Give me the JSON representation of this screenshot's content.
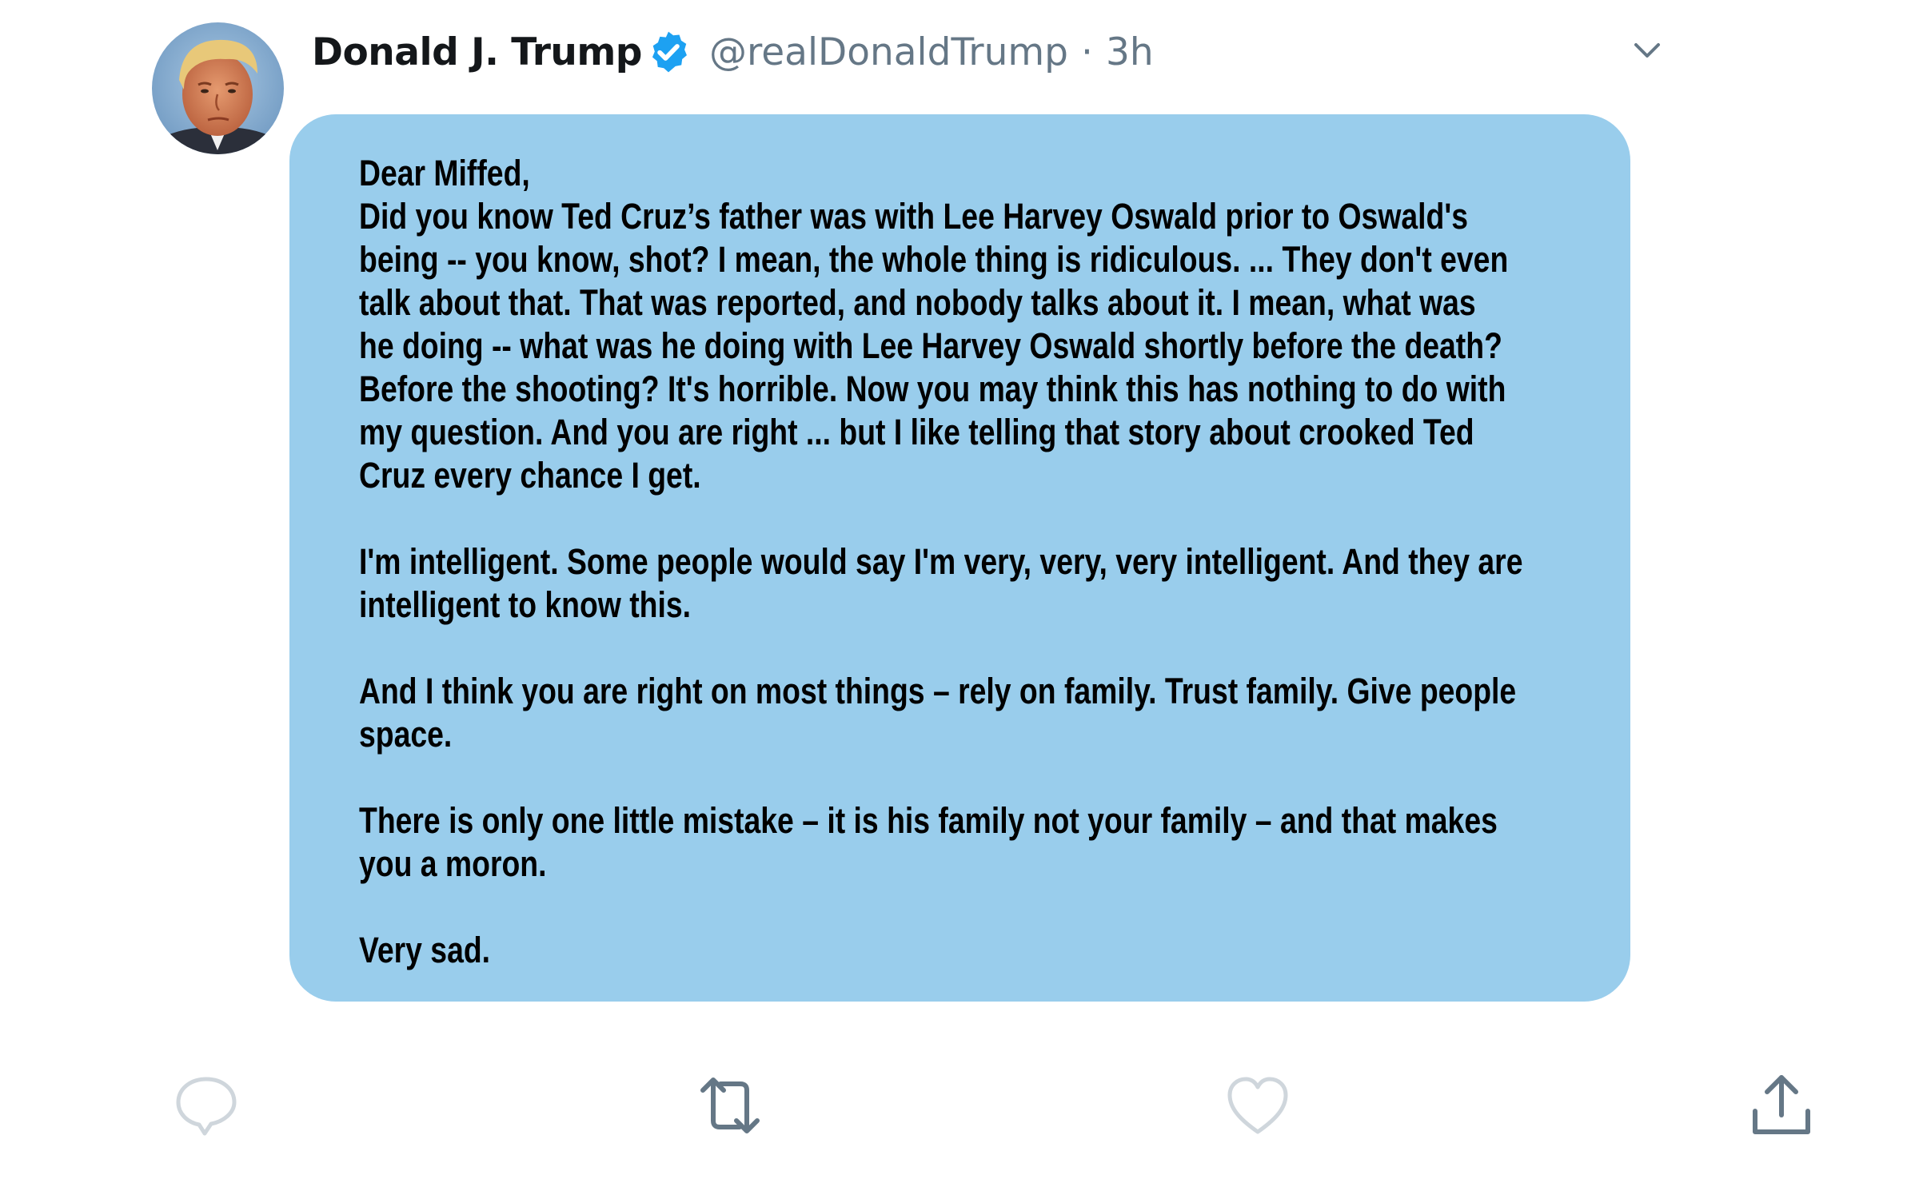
{
  "tweet": {
    "display_name": "Donald J. Trump",
    "handle": "@realDonaldTrump",
    "separator": "·",
    "timestamp": "3h",
    "verified": true,
    "menu_icon": "chevron-down-icon",
    "bubble_color": "#99cdec",
    "paragraphs": [
      {
        "lines": [
          "Dear Miffed,",
          "Did you know Ted Cruz’s father was with Lee Harvey Oswald prior to Oswald's",
          "being -- you know, shot? I mean, the whole thing is ridiculous. ... They don't even",
          "talk about that. That was reported, and nobody talks about it. I mean, what was",
          "he doing -- what was he doing with Lee Harvey Oswald shortly before the death?",
          "Before the shooting? It's horrible. Now you may think this has nothing to do with",
          "my question. And you are right ... but I like telling that story about crooked Ted",
          "Cruz every chance I get."
        ]
      },
      {
        "lines": [
          "I'm intelligent. Some people would say I'm very, very, very intelligent. And they are",
          "intelligent to know this."
        ]
      },
      {
        "lines": [
          "And I think you are right on most things – rely on family. Trust family. Give people",
          "space."
        ]
      },
      {
        "lines": [
          "There is only one little mistake – it is his family not your family – and that makes",
          "you a moron."
        ]
      },
      {
        "lines": [
          "Very sad."
        ]
      }
    ]
  },
  "actions": {
    "reply_icon": "reply-icon",
    "retweet_icon": "retweet-icon",
    "like_icon": "heart-icon",
    "share_icon": "share-icon",
    "icon_color": "#657786",
    "verified_color": "#1da1f2"
  }
}
